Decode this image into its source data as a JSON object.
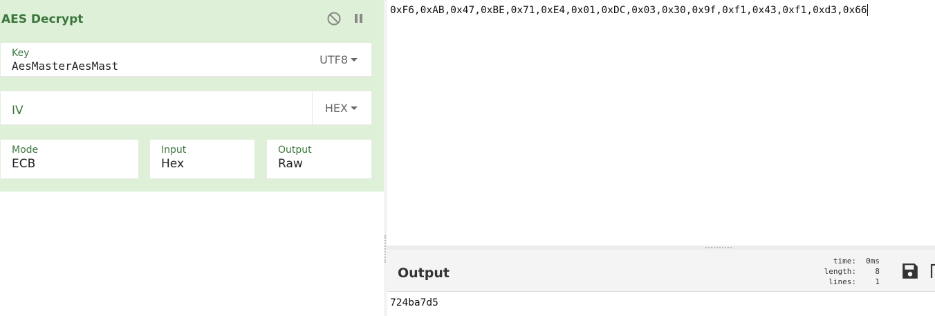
{
  "operation": {
    "title": "AES Decrypt",
    "key": {
      "label": "Key",
      "value": "AesMasterAesMast",
      "encoding": "UTF8"
    },
    "iv": {
      "label": "IV",
      "value": "",
      "encoding": "HEX"
    },
    "mode": {
      "label": "Mode",
      "value": "ECB"
    },
    "input": {
      "label": "Input",
      "value": "Hex"
    },
    "output": {
      "label": "Output",
      "value": "Raw"
    },
    "icons": {
      "disable": "disable-icon",
      "pause": "pause-icon"
    }
  },
  "input_pane": {
    "text": "0xF6,0xAB,0x47,0xBE,0x71,0xE4,0x01,0xDC,0x03,0x30,0x9f,0xf1,0x43,0xf1,0xd3,0x66"
  },
  "output_pane": {
    "title": "Output",
    "stats": {
      "time_label": "time:",
      "time_value": "0ms",
      "length_label": "length:",
      "length_value": "8",
      "lines_label": "lines:",
      "lines_value": "1"
    },
    "text": "724ba7d5",
    "icons": {
      "save": "save-icon",
      "copy": "copy-icon"
    }
  },
  "colors": {
    "operation_bg": "#dff0d8",
    "accent_green": "#3c763d"
  }
}
